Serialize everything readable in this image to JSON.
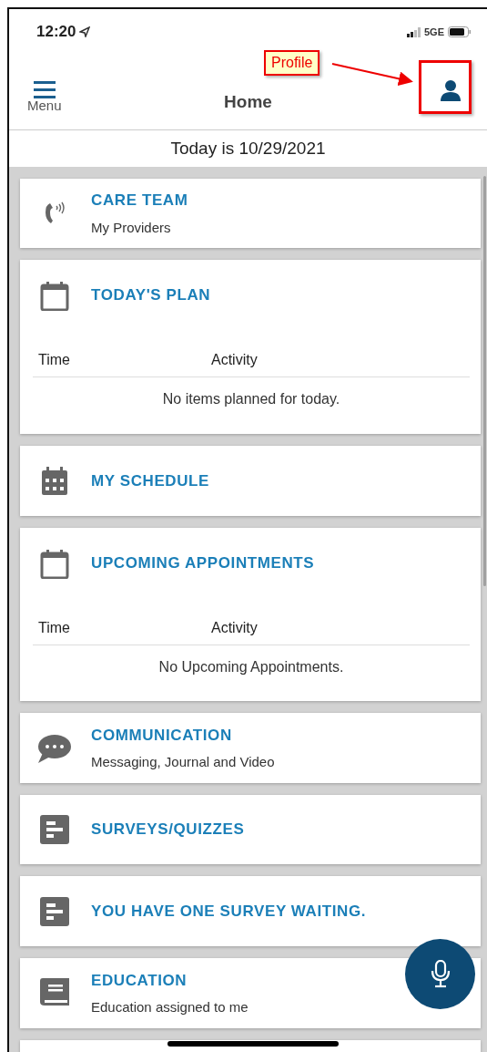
{
  "status_bar": {
    "time": "12:20",
    "network": "5GE"
  },
  "header": {
    "menu_label": "Menu",
    "title": "Home"
  },
  "annotation": {
    "label": "Profile"
  },
  "date_banner": "Today is 10/29/2021",
  "cards": [
    {
      "kind": "link",
      "title": "CARE TEAM",
      "subtitle": "My Providers"
    },
    {
      "kind": "table",
      "title": "TODAY'S PLAN",
      "columns": [
        "Time",
        "Activity"
      ],
      "empty_message": "No items planned for today."
    },
    {
      "kind": "link",
      "title": "MY SCHEDULE"
    },
    {
      "kind": "table",
      "title": "UPCOMING APPOINTMENTS",
      "columns": [
        "Time",
        "Activity"
      ],
      "empty_message": "No Upcoming Appointments."
    },
    {
      "kind": "link",
      "title": "COMMUNICATION",
      "subtitle": "Messaging, Journal and Video"
    },
    {
      "kind": "link",
      "title": "SURVEYS/QUIZZES"
    },
    {
      "kind": "link",
      "title": "YOU HAVE ONE SURVEY WAITING."
    },
    {
      "kind": "link",
      "title": "EDUCATION",
      "subtitle": "Education assigned to me"
    }
  ]
}
